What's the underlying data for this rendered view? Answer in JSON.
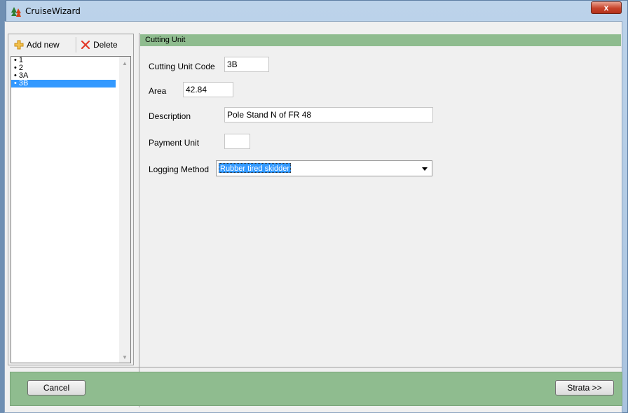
{
  "window": {
    "title": "CruiseWizard",
    "close_symbol": "x"
  },
  "toolbar": {
    "add_label": "Add new",
    "delete_label": "Delete"
  },
  "list": {
    "items": [
      {
        "label": "• 1",
        "selected": false
      },
      {
        "label": "• 2",
        "selected": false
      },
      {
        "label": "• 3A",
        "selected": false
      },
      {
        "label": "• 3B",
        "selected": true
      }
    ]
  },
  "panel": {
    "header": "Cutting Unit",
    "fields": {
      "code_label": "Cutting Unit Code",
      "code_value": "3B",
      "area_label": "Area",
      "area_value": "42.84",
      "description_label": "Description",
      "description_value": "Pole Stand N of FR 48",
      "payment_label": "Payment Unit",
      "payment_value": "",
      "logging_label": "Logging Method",
      "logging_value": "Rubber tired skidder"
    }
  },
  "footer": {
    "cancel_label": "Cancel",
    "next_label": "Strata >>"
  },
  "colors": {
    "panel_green": "#8fbc8f",
    "selection": "#3399ff",
    "delete_red": "#e23a2a",
    "add_orange": "#e8a317"
  }
}
